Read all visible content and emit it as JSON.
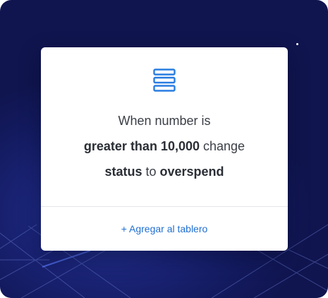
{
  "card": {
    "line1": "When number is",
    "condition": "greater than 10,000",
    "verb": "change",
    "field": "status",
    "connector": "to",
    "value": "overspend",
    "action_label": "+ Agregar al tablero",
    "icon": "list-icon"
  },
  "colors": {
    "background": "#151c63",
    "accent": "#1f6fd1",
    "text": "#2c3138"
  }
}
